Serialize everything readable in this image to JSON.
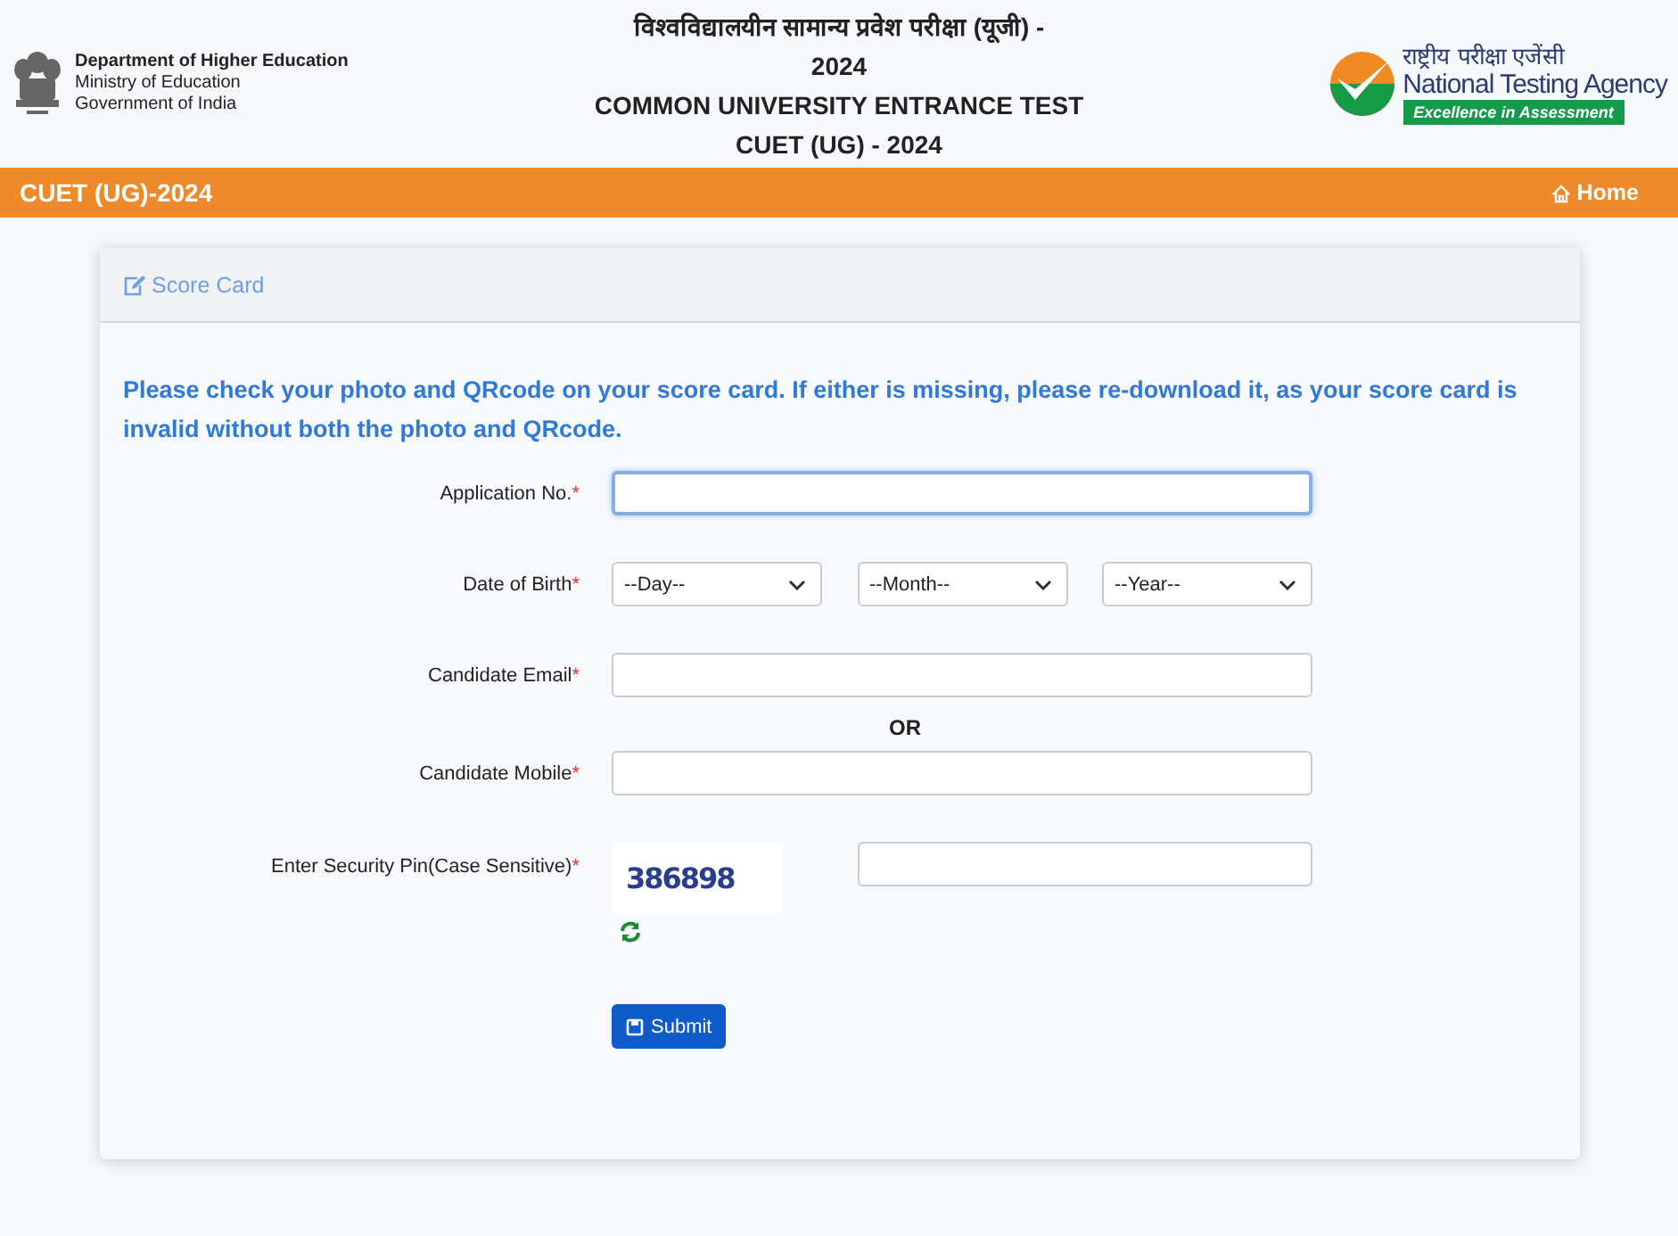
{
  "header": {
    "ministry": {
      "department": "Department of Higher Education",
      "ministry": "Ministry of Education",
      "government": "Government of India"
    },
    "title_lines": [
      "विश्वविद्यालयीन सामान्य प्रवेश परीक्षा (यूजी) -",
      "2024",
      "COMMON UNIVERSITY ENTRANCE TEST",
      "CUET (UG) - 2024"
    ],
    "agency": {
      "hindi": "राष्ट्रीय परीक्षा एजेंसी",
      "name": "National Testing Agency",
      "tagline": "Excellence in Assessment"
    }
  },
  "navbar": {
    "brand": "CUET (UG)-2024",
    "home": "Home"
  },
  "card": {
    "title": "Score Card",
    "notice": "Please check your photo and QRcode on your score card. If either is missing, please re-download it, as your score card is invalid without both the photo and QRcode.",
    "fields": [
      {
        "kind": "text",
        "label": "Application No.",
        "required_mark": "*",
        "focused": true
      },
      {
        "kind": "dob",
        "label": "Date of Birth",
        "required_mark": "*",
        "selects": [
          "--Day--",
          "--Month--",
          "--Year--"
        ]
      },
      {
        "kind": "text",
        "label": "Candidate Email",
        "required_mark": "*",
        "focused": false
      },
      {
        "kind": "separator",
        "text": "OR"
      },
      {
        "kind": "text",
        "label": "Candidate Mobile",
        "required_mark": "*",
        "focused": false
      },
      {
        "kind": "captcha",
        "label": "Enter Security Pin(Case Sensitive)",
        "required_mark": "*",
        "captcha": "386898"
      }
    ],
    "submit": "Submit"
  }
}
